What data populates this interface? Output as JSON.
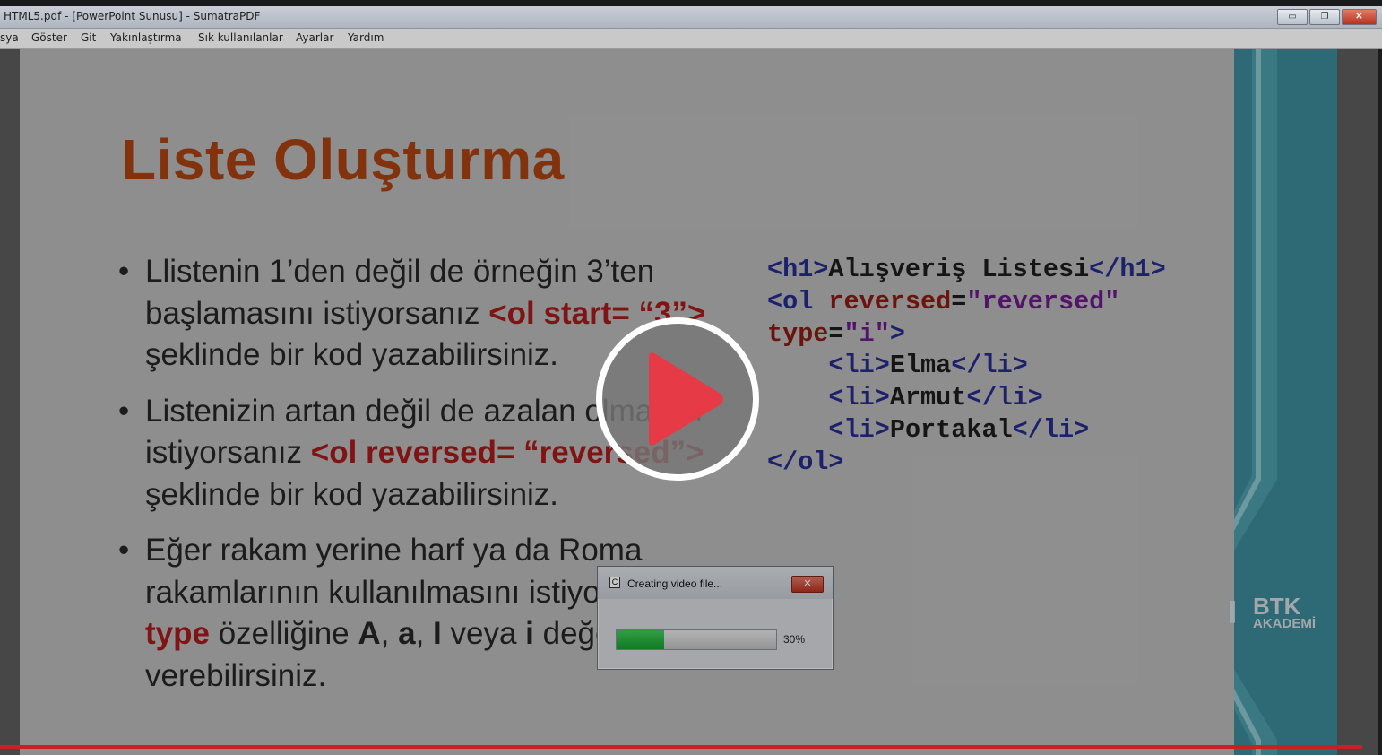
{
  "window": {
    "title": "HTML5.pdf - [PowerPoint Sunusu] - SumatraPDF",
    "controls": {
      "minimize": "▭",
      "maximize": "❐",
      "close": "✕"
    }
  },
  "menu": [
    "sya",
    "Göster",
    "Git",
    "Yakınlaştırma",
    "Sık kullanılanlar",
    "Ayarlar",
    "Yardım"
  ],
  "slide": {
    "title": "Liste Oluşturma",
    "bullets": [
      {
        "a": "Llistenin 1’den değil de örneğin 3’ten başlamasını istiyorsanız ",
        "code": "<ol start= “3”>",
        "b": " şeklinde bir kod yazabilirsiniz."
      },
      {
        "a": "Listenizin artan değil de azalan olmasını istiyorsanız ",
        "code": "<ol reversed= “reversed”>",
        "b": " şeklinde bir kod yazabilirsiniz."
      },
      {
        "a": "Eğer rakam yerine harf ya da Roma rakamlarının kullanılmasını istiyorsanız ",
        "type": "type",
        "b": " özelliğine ",
        "A": "A",
        "sep1": ", ",
        "a2": "a",
        "sep2": ", ",
        "I": "I",
        "veya": " veya ",
        "i": "i",
        "c": " değerlerini verebilirsiniz."
      }
    ],
    "code": {
      "l1_open": "<h1>",
      "l1_text": "Alışveriş Listesi",
      "l1_close": "</h1>",
      "l2_tag": "<ol ",
      "l2_attr": "reversed",
      "l2_eq": "=",
      "l2_val": "\"reversed\"",
      "l3_attr": "type",
      "l3_eq": "=",
      "l3_val": "\"i\"",
      "l3_end": ">",
      "li_open": "<li>",
      "li_close": "</li>",
      "items": [
        "Elma",
        "Armut",
        "Portakal"
      ],
      "l7": "</ol>"
    },
    "logo": {
      "line1": "BTK",
      "line2": "AKADEMİ"
    }
  },
  "dialog": {
    "title": "Creating video file...",
    "close": "✕",
    "progress": 0.3,
    "progress_label": "30%"
  },
  "player": {
    "progress": 0.986
  },
  "colors": {
    "accent_title": "#a74212",
    "red_code": "#a51a1a",
    "play_red": "#e63a47",
    "teal": "#3b8896"
  }
}
